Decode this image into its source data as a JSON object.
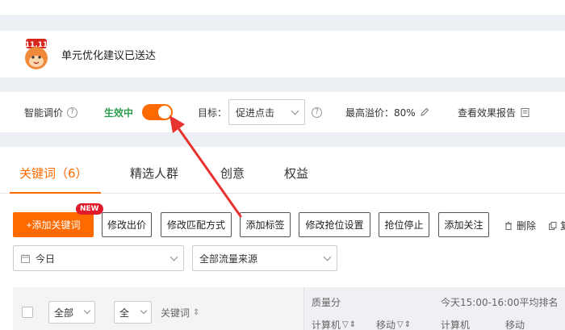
{
  "notice": {
    "text": "单元优化建议已送达"
  },
  "settings": {
    "smart_bid_label": "智能调价",
    "status_label": "生效中",
    "goal_label": "目标：",
    "goal_value": "促进点击",
    "max_premium_label": "最高溢价：80%",
    "report_label": "查看效果报告",
    "toggle_on": true
  },
  "tabs": [
    {
      "label": "关键词（6）",
      "active": true
    },
    {
      "label": "精选人群",
      "active": false
    },
    {
      "label": "创意",
      "active": false
    },
    {
      "label": "权益",
      "active": false
    }
  ],
  "toolbar": {
    "add_keyword": "+添加关键词",
    "new_badge": "NEW",
    "edit_bid": "修改出价",
    "edit_match": "修改匹配方式",
    "add_tag": "添加标签",
    "edit_grab": "修改抢位设置",
    "stop_grab": "抢位停止",
    "add_follow": "添加关注",
    "delete": "删除",
    "copy_partial": "复"
  },
  "filters": {
    "date": "今日",
    "traffic_source": "全部流量来源"
  },
  "table": {
    "sel_all_1": "全部",
    "sel_all_2": "全",
    "keyword_col": "关键词",
    "quality_score": "质量分",
    "pc_col": "计算机",
    "mobile_col": "移动",
    "rank_header": "今天15:00-16:00平均排名",
    "rank_pc": "计算机",
    "rank_mobile": "移动"
  },
  "colors": {
    "accent": "#ff6a00",
    "status_green": "#2e9c4d",
    "badge_red": "#e0192b",
    "arrow_red": "#e8322f"
  }
}
